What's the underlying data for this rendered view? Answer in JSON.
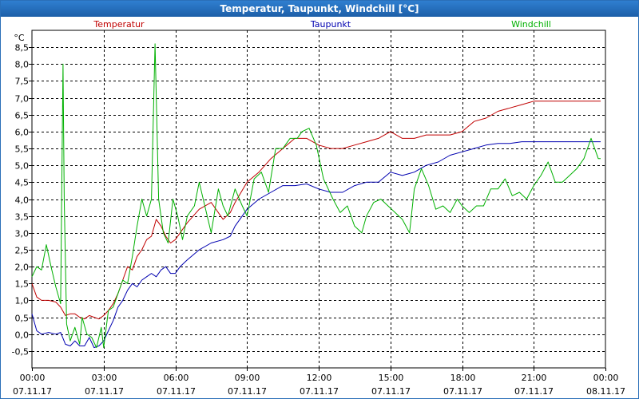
{
  "window": {
    "title": "Temperatur, Taupunkt, Windchill [°C]"
  },
  "chart_data": {
    "type": "line",
    "title": "Temperatur, Taupunkt, Windchill [°C]",
    "ylabel": "°C",
    "ylim": [
      -1.0,
      9.0
    ],
    "yticks": [
      -0.5,
      0.0,
      0.5,
      1.0,
      1.5,
      2.0,
      2.5,
      3.0,
      3.5,
      4.0,
      4.5,
      5.0,
      5.5,
      6.0,
      6.5,
      7.0,
      7.5,
      8.0,
      8.5
    ],
    "ytick_labels": [
      "-0,5",
      "0,0",
      "0,5",
      "1,0",
      "1,5",
      "2,0",
      "2,5",
      "3,0",
      "3,5",
      "4,0",
      "4,5",
      "5,0",
      "5,5",
      "6,0",
      "6,5",
      "7,0",
      "7,5",
      "8,0",
      "8,5"
    ],
    "xlim": [
      0,
      24
    ],
    "xticks": [
      0,
      3,
      6,
      9,
      12,
      15,
      18,
      21,
      24
    ],
    "xtick_times": [
      "00:00",
      "03:00",
      "06:00",
      "09:00",
      "12:00",
      "15:00",
      "18:00",
      "21:00",
      "00:00"
    ],
    "xtick_dates": [
      "07.11.17",
      "07.11.17",
      "07.11.17",
      "07.11.17",
      "07.11.17",
      "07.11.17",
      "07.11.17",
      "07.11.17",
      "08.11.17"
    ],
    "grid": true,
    "legend_position": "top",
    "series": [
      {
        "name": "Temperatur",
        "color": "#c00000",
        "x": [
          0,
          0.2,
          0.4,
          0.7,
          1.0,
          1.2,
          1.4,
          1.6,
          1.8,
          2.0,
          2.2,
          2.4,
          2.6,
          2.8,
          3.0,
          3.2,
          3.4,
          3.6,
          3.8,
          4.0,
          4.2,
          4.4,
          4.6,
          4.8,
          5.0,
          5.2,
          5.4,
          5.6,
          5.8,
          6.0,
          6.2,
          6.5,
          7.0,
          7.5,
          8.0,
          8.3,
          8.5,
          9.0,
          9.5,
          10.0,
          10.5,
          11.0,
          11.5,
          12.0,
          12.5,
          13.0,
          13.5,
          14.0,
          14.5,
          15.0,
          15.5,
          16.0,
          16.5,
          17.0,
          17.5,
          18.0,
          18.5,
          19.0,
          19.5,
          20.0,
          20.5,
          21.0,
          21.5,
          22.0,
          22.5,
          23.0,
          23.5,
          23.8
        ],
        "values": [
          1.5,
          1.1,
          1.0,
          1.0,
          0.95,
          0.8,
          0.55,
          0.6,
          0.6,
          0.5,
          0.45,
          0.55,
          0.5,
          0.45,
          0.55,
          0.7,
          0.9,
          1.2,
          1.6,
          2.0,
          1.9,
          2.3,
          2.5,
          2.8,
          2.9,
          3.4,
          3.2,
          2.9,
          2.7,
          2.8,
          3.0,
          3.3,
          3.7,
          3.9,
          3.4,
          3.6,
          3.9,
          4.5,
          4.8,
          5.2,
          5.5,
          5.8,
          5.8,
          5.6,
          5.5,
          5.5,
          5.6,
          5.7,
          5.8,
          6.0,
          5.8,
          5.8,
          5.9,
          5.9,
          5.9,
          6.0,
          6.3,
          6.4,
          6.6,
          6.7,
          6.8,
          6.9,
          6.9,
          6.9,
          6.9,
          6.9,
          6.9,
          6.9
        ]
      },
      {
        "name": "Taupunkt",
        "color": "#0000b0",
        "x": [
          0,
          0.2,
          0.4,
          0.7,
          1.0,
          1.2,
          1.4,
          1.6,
          1.8,
          2.0,
          2.2,
          2.4,
          2.6,
          2.8,
          3.0,
          3.2,
          3.4,
          3.6,
          3.8,
          4.0,
          4.2,
          4.4,
          4.6,
          4.8,
          5.0,
          5.2,
          5.4,
          5.6,
          5.8,
          6.0,
          6.2,
          6.5,
          7.0,
          7.5,
          8.0,
          8.3,
          8.5,
          9.0,
          9.5,
          10.0,
          10.5,
          11.0,
          11.5,
          12.0,
          12.5,
          13.0,
          13.5,
          14.0,
          14.5,
          15.0,
          15.5,
          16.0,
          16.5,
          17.0,
          17.5,
          18.0,
          18.5,
          19.0,
          19.5,
          20.0,
          20.5,
          21.0,
          21.5,
          22.0,
          22.5,
          23.0,
          23.5,
          23.8
        ],
        "values": [
          0.6,
          0.1,
          0.0,
          0.05,
          0.0,
          0.05,
          -0.3,
          -0.35,
          -0.2,
          -0.35,
          -0.35,
          -0.1,
          -0.4,
          -0.35,
          -0.2,
          0.1,
          0.4,
          0.8,
          1.0,
          1.3,
          1.5,
          1.4,
          1.6,
          1.7,
          1.8,
          1.7,
          1.9,
          2.0,
          1.8,
          1.8,
          2.0,
          2.2,
          2.5,
          2.7,
          2.8,
          2.9,
          3.2,
          3.7,
          4.0,
          4.2,
          4.4,
          4.4,
          4.45,
          4.3,
          4.2,
          4.2,
          4.4,
          4.5,
          4.5,
          4.8,
          4.7,
          4.8,
          5.0,
          5.1,
          5.3,
          5.4,
          5.5,
          5.6,
          5.65,
          5.65,
          5.7,
          5.7,
          5.7,
          5.7,
          5.7,
          5.7,
          5.7,
          5.7
        ]
      },
      {
        "name": "Windchill",
        "color": "#00b000",
        "x": [
          0,
          0.2,
          0.4,
          0.6,
          0.8,
          1.0,
          1.2,
          1.3,
          1.35,
          1.45,
          1.6,
          1.8,
          2.0,
          2.1,
          2.3,
          2.5,
          2.7,
          2.9,
          3.0,
          3.2,
          3.4,
          3.6,
          3.8,
          4.0,
          4.2,
          4.4,
          4.6,
          4.8,
          5.0,
          5.15,
          5.3,
          5.5,
          5.7,
          5.9,
          6.1,
          6.3,
          6.5,
          6.8,
          7.0,
          7.3,
          7.5,
          7.8,
          8.0,
          8.2,
          8.5,
          8.8,
          9.0,
          9.3,
          9.6,
          9.9,
          10.2,
          10.5,
          10.8,
          11.1,
          11.3,
          11.6,
          11.9,
          12.2,
          12.6,
          12.9,
          13.2,
          13.5,
          13.8,
          14.0,
          14.3,
          14.6,
          14.9,
          15.2,
          15.5,
          15.8,
          16.0,
          16.3,
          16.6,
          16.9,
          17.2,
          17.5,
          17.8,
          18.0,
          18.3,
          18.6,
          18.9,
          19.2,
          19.5,
          19.8,
          20.1,
          20.4,
          20.7,
          21.0,
          21.3,
          21.6,
          21.9,
          22.2,
          22.5,
          22.8,
          23.1,
          23.4,
          23.7,
          23.8
        ],
        "values": [
          1.7,
          2.0,
          1.9,
          2.65,
          2.0,
          1.4,
          0.9,
          8.0,
          4.0,
          0.3,
          -0.2,
          0.2,
          -0.3,
          0.5,
          0.0,
          -0.1,
          -0.4,
          0.2,
          -0.4,
          0.7,
          0.8,
          1.2,
          1.6,
          1.5,
          2.3,
          3.2,
          4.0,
          3.5,
          4.0,
          8.6,
          4.0,
          3.0,
          2.7,
          4.0,
          3.5,
          2.8,
          3.5,
          3.8,
          4.5,
          3.6,
          3.0,
          4.3,
          3.8,
          3.5,
          4.3,
          3.8,
          3.5,
          4.6,
          4.8,
          4.2,
          5.5,
          5.5,
          5.8,
          5.8,
          6.0,
          6.1,
          5.6,
          4.6,
          4.0,
          3.6,
          3.8,
          3.2,
          3.0,
          3.5,
          3.9,
          4.0,
          3.8,
          3.6,
          3.4,
          3.0,
          4.3,
          4.9,
          4.4,
          3.7,
          3.8,
          3.6,
          4.0,
          3.8,
          3.6,
          3.8,
          3.8,
          4.3,
          4.3,
          4.6,
          4.1,
          4.2,
          4.0,
          4.4,
          4.7,
          5.1,
          4.5,
          4.5,
          4.7,
          4.9,
          5.2,
          5.8,
          5.2,
          5.2
        ]
      }
    ]
  }
}
